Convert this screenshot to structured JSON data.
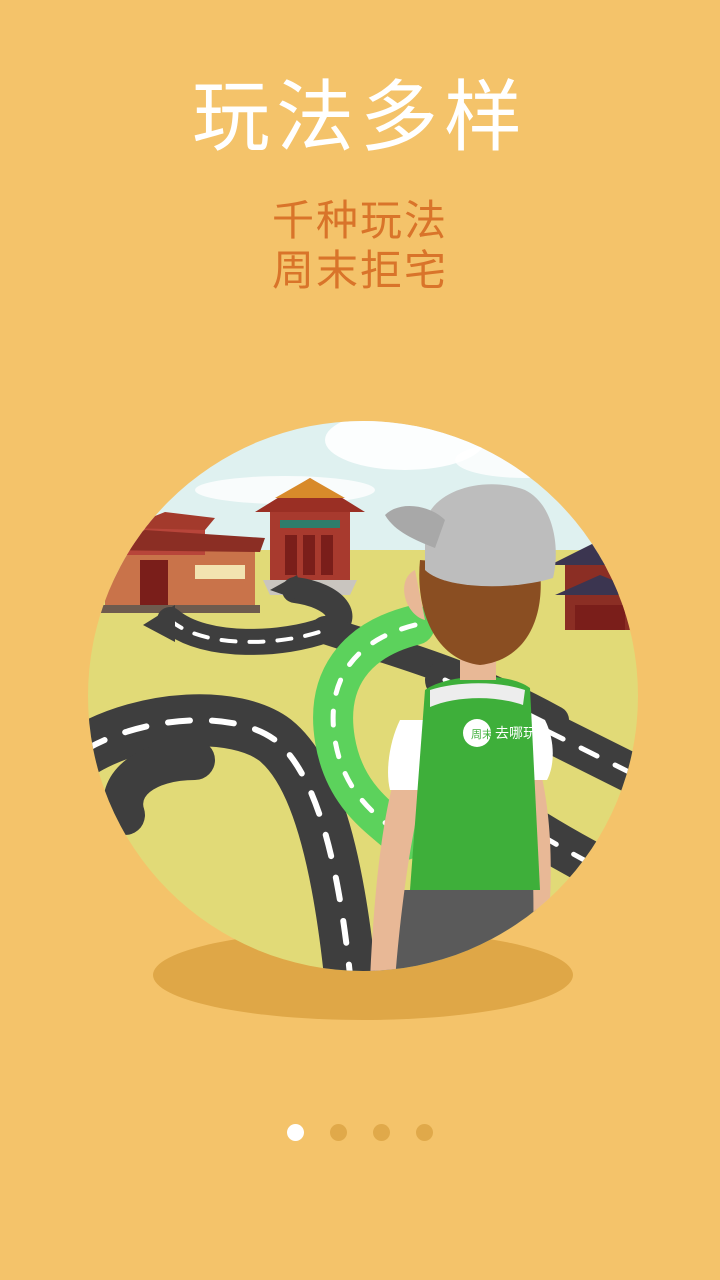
{
  "guide": {
    "title": "玩法多样",
    "subtitle_line1": "千种玩法",
    "subtitle_line2": "周末拒宅"
  },
  "badge": {
    "brand": "去哪玩",
    "logo_char": "周末"
  },
  "pager": {
    "pages": 4,
    "active_index": 0
  },
  "colors": {
    "background": "#F4C36A",
    "title": "#FFFFFF",
    "subtitle": "#D9742A",
    "dot_active": "#FFFFFF",
    "dot_inactive": "#E0A94A"
  }
}
